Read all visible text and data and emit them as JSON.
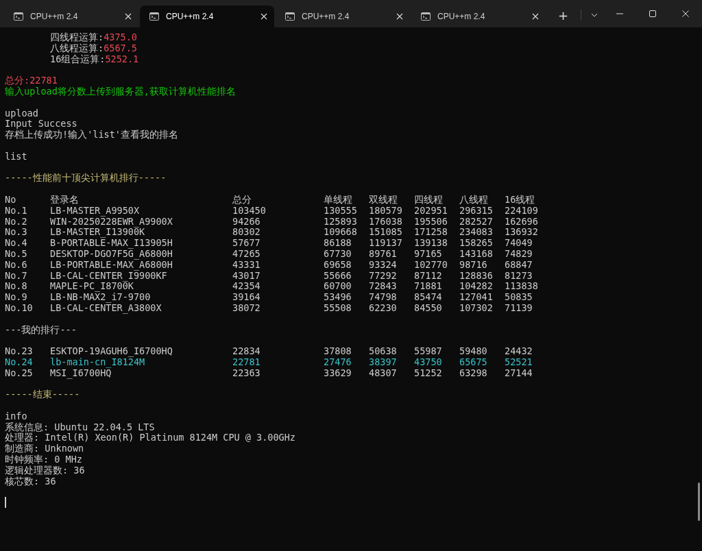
{
  "tabs": [
    {
      "title": "CPU++m 2.4",
      "selected": false
    },
    {
      "title": "CPU++m 2.4",
      "selected": true
    },
    {
      "title": "CPU++m 2.4",
      "selected": false
    },
    {
      "title": "CPU++m 2.4",
      "selected": false
    }
  ],
  "new_tab": "+",
  "console": [
    {
      "kind": "score",
      "label": "四线程运算:",
      "value": "4375.0"
    },
    {
      "kind": "score",
      "label": "八线程运算:",
      "value": "6567.5"
    },
    {
      "kind": "score",
      "label": "16组合运算:",
      "value": "5252.1"
    },
    {
      "kind": "blank"
    },
    {
      "kind": "total",
      "text": "总分:22781"
    },
    {
      "kind": "hint",
      "text": "输入upload将分数上传到服务器,获取计算机性能排名"
    },
    {
      "kind": "blank"
    },
    {
      "kind": "text",
      "text": "upload"
    },
    {
      "kind": "text",
      "text": "Input Success"
    },
    {
      "kind": "text",
      "text": "存档上传成功!输入'list'查看我的排名"
    },
    {
      "kind": "blank"
    },
    {
      "kind": "text",
      "text": "list"
    },
    {
      "kind": "blank"
    },
    {
      "kind": "heading",
      "text": "-----性能前十顶尖计算机排行-----"
    },
    {
      "kind": "blank"
    },
    {
      "kind": "table",
      "columns": [
        "No",
        "登录名",
        "总分",
        "单线程",
        "双线程",
        "四线程",
        "八线程",
        "16线程"
      ],
      "rows": [
        {
          "cells": [
            "No.1",
            "LB-MASTER_A9950X",
            "103450",
            "130555",
            "180579",
            "202951",
            "296315",
            "224109"
          ],
          "highlighted": false
        },
        {
          "cells": [
            "No.2",
            "WIN-20250228EWR_A9900X",
            "94266",
            "125893",
            "176038",
            "195506",
            "282527",
            "162696"
          ],
          "highlighted": false
        },
        {
          "cells": [
            "No.3",
            "LB-MASTER_I13900K",
            "80302",
            "109668",
            "151085",
            "171258",
            "234083",
            "136932"
          ],
          "highlighted": false
        },
        {
          "cells": [
            "No.4",
            "B-PORTABLE-MAX_I13905H",
            "57677",
            "86188",
            "119137",
            "139138",
            "158265",
            "74049"
          ],
          "highlighted": false
        },
        {
          "cells": [
            "No.5",
            "DESKTOP-DGO7F5G_A6800H",
            "47265",
            "67730",
            "89761",
            "97165",
            "143168",
            "74829"
          ],
          "highlighted": false
        },
        {
          "cells": [
            "No.6",
            "LB-PORTABLE-MAX_A6800H",
            "43331",
            "69658",
            "93324",
            "102770",
            "98716",
            "68847"
          ],
          "highlighted": false
        },
        {
          "cells": [
            "No.7",
            "LB-CAL-CENTER_I9900KF",
            "43017",
            "55666",
            "77292",
            "87112",
            "128836",
            "81273"
          ],
          "highlighted": false
        },
        {
          "cells": [
            "No.8",
            "MAPLE-PC_I8700K",
            "42354",
            "60700",
            "72843",
            "71881",
            "104282",
            "113838"
          ],
          "highlighted": false
        },
        {
          "cells": [
            "No.9",
            "LB-NB-MAX2_i7-9700",
            "39164",
            "53496",
            "74798",
            "85474",
            "127041",
            "50835"
          ],
          "highlighted": false
        },
        {
          "cells": [
            "No.10",
            "LB-CAL-CENTER_A3800X",
            "38072",
            "55508",
            "62230",
            "84550",
            "107302",
            "71139"
          ],
          "highlighted": false
        }
      ]
    },
    {
      "kind": "blank"
    },
    {
      "kind": "text",
      "text": "---我的排行---"
    },
    {
      "kind": "blank"
    },
    {
      "kind": "table",
      "rows": [
        {
          "cells": [
            "No.23",
            "ESKTOP-19AGUH6_I6700HQ",
            "22834",
            "37808",
            "50638",
            "55987",
            "59480",
            "24432"
          ],
          "highlighted": false
        },
        {
          "cells": [
            "No.24",
            "lb-main-cn_I8124M",
            "22781",
            "27476",
            "38397",
            "43750",
            "65675",
            "52521"
          ],
          "highlighted": true
        },
        {
          "cells": [
            "No.25",
            "MSI_I6700HQ",
            "22363",
            "33629",
            "48307",
            "51252",
            "63298",
            "27144"
          ],
          "highlighted": false
        }
      ]
    },
    {
      "kind": "blank"
    },
    {
      "kind": "heading",
      "text": "-----结束-----"
    },
    {
      "kind": "blank"
    },
    {
      "kind": "text",
      "text": "info"
    },
    {
      "kind": "text",
      "text": "系统信息: Ubuntu 22.04.5 LTS"
    },
    {
      "kind": "text",
      "text": "处理器: Intel(R) Xeon(R) Platinum 8124M CPU @ 3.00GHz"
    },
    {
      "kind": "text",
      "text": "制造商: Unknown"
    },
    {
      "kind": "text",
      "text": "时钟频率: 0 MHz"
    },
    {
      "kind": "text",
      "text": "逻辑处理器数: 36"
    },
    {
      "kind": "text",
      "text": "核芯数: 36"
    },
    {
      "kind": "blank"
    },
    {
      "kind": "cursor"
    }
  ]
}
